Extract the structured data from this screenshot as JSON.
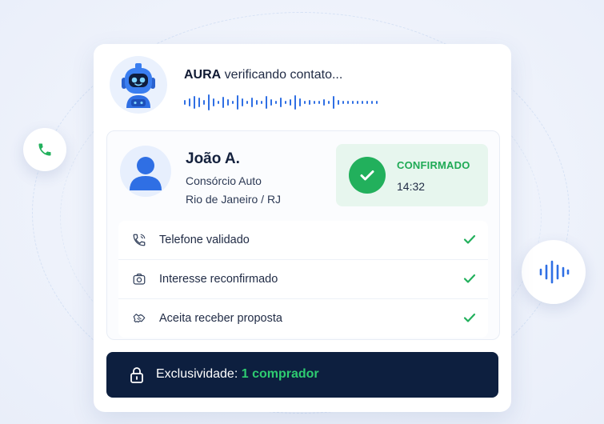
{
  "header": {
    "agent_name": "AURA",
    "status_text": " verificando contato..."
  },
  "contact": {
    "name": "João A.",
    "category": "Consórcio Auto",
    "location": "Rio de Janeiro / RJ"
  },
  "status": {
    "label": "CONFIRMADO",
    "time": "14:32",
    "color": "#22b05c"
  },
  "checklist": [
    {
      "label": "Telefone validado",
      "icon": "phone-icon",
      "checked": true
    },
    {
      "label": "Interesse reconfirmado",
      "icon": "camera-icon",
      "checked": true
    },
    {
      "label": "Aceita receber proposta",
      "icon": "handshake-icon",
      "checked": true
    }
  ],
  "exclusivity": {
    "label": "Exclusividade:",
    "value": "1 comprador",
    "icon": "lock-icon"
  },
  "colors": {
    "brand_blue": "#2f6fe4",
    "success_green": "#22b05c",
    "dark_navy": "#0d1f3f"
  },
  "floating": {
    "left_icon": "phone-icon",
    "right_icon": "voice-wave-icon"
  }
}
